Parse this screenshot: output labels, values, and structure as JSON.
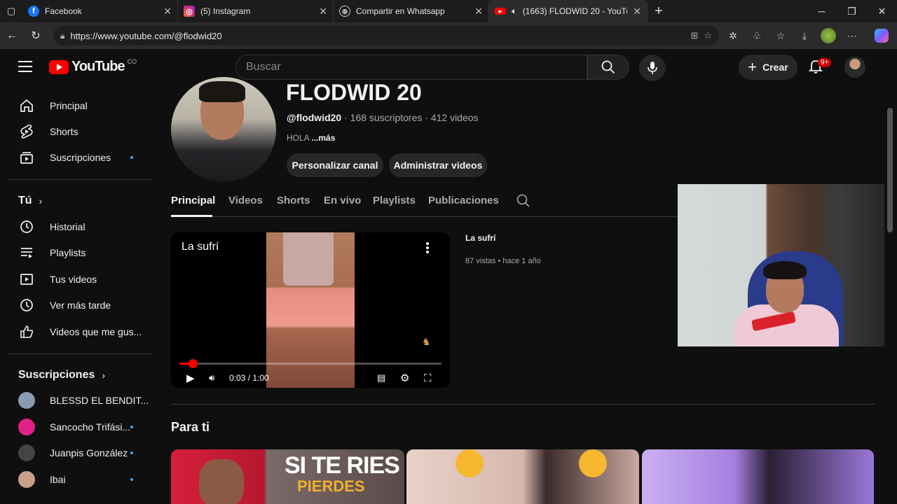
{
  "browser": {
    "tabs": [
      {
        "label": "Facebook",
        "icon": "facebook-icon",
        "color": "#1877f2"
      },
      {
        "label": "(5) Instagram",
        "icon": "instagram-icon",
        "color": "#d62976"
      },
      {
        "label": "Compartir en Whatsapp",
        "icon": "globe-icon",
        "color": "#888888"
      },
      {
        "label": "(1663) FLODWID 20 - YouTub",
        "icon": "youtube-icon",
        "color": "#ff0000"
      }
    ],
    "url": "https://www.youtube.com/@flodwid20"
  },
  "yt": {
    "logo_text": "YouTube",
    "country": "CO",
    "search_placeholder": "Buscar",
    "create_label": "Crear",
    "notif_badge": "9+"
  },
  "sidebar": {
    "main": [
      {
        "label": "Principal",
        "icon": "home-icon"
      },
      {
        "label": "Shorts",
        "icon": "shorts-icon"
      },
      {
        "label": "Suscripciones",
        "icon": "subscriptions-icon"
      }
    ],
    "you_label": "Tú",
    "you_items": [
      {
        "label": "Historial",
        "icon": "history-icon"
      },
      {
        "label": "Playlists",
        "icon": "playlists-icon"
      },
      {
        "label": "Tus videos",
        "icon": "your-videos-icon"
      },
      {
        "label": "Ver más tarde",
        "icon": "watch-later-icon"
      },
      {
        "label": "Videos que me gus...",
        "icon": "thumbs-up-icon"
      }
    ],
    "subs_label": "Suscripciones",
    "subs": [
      {
        "label": "BLESSD EL BENDIT...",
        "color": "#8a9bb0"
      },
      {
        "label": "Sancocho Trifási...",
        "color": "#e0218a"
      },
      {
        "label": "Juanpis González",
        "color": "#444444"
      },
      {
        "label": "Ibai",
        "color": "#c9a08a"
      }
    ]
  },
  "channel": {
    "name": "FLODWID 20",
    "handle": "@flodwid20",
    "stats": " · 168 suscriptores · 412 videos",
    "desc": "HOLA ",
    "more": "...más",
    "btn_customize": "Personalizar canal",
    "btn_manage": "Administrar videos",
    "tabs": [
      "Principal",
      "Videos",
      "Shorts",
      "En vivo",
      "Playlists",
      "Publicaciones"
    ]
  },
  "featured": {
    "title": "La sufrí",
    "time": "0:03 / 1:00",
    "progress": 0.05,
    "info_title": "La sufrí",
    "info_meta": "87 vistas • hace 1 año"
  },
  "section": {
    "title": "Para ti",
    "thumb_text_1": "SI TE RIES",
    "thumb_text_2": "PIERDES"
  }
}
